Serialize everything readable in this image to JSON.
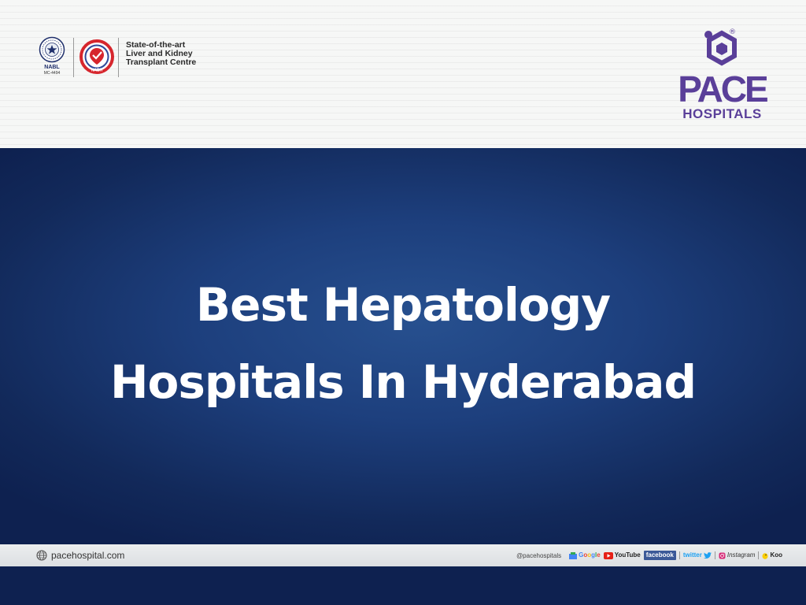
{
  "header": {
    "nabl": {
      "label": "NABL",
      "code": "MC-4494"
    },
    "nabh_label": "NABH",
    "tagline": [
      "State-of-the-art",
      "Liver and Kidney",
      "Transplant Centre"
    ],
    "brand": {
      "name": "PACE",
      "subname": "HOSPITALS",
      "registered": "®"
    }
  },
  "hero": {
    "title_lines": [
      "Best Hepatology",
      "Hospitals In Hyderabad"
    ]
  },
  "footer": {
    "website": "pacehospital.com",
    "handle": "@pacehospitals",
    "socials": {
      "google": "Google",
      "youtube": "YouTube",
      "facebook": "facebook",
      "twitter": "twitter",
      "instagram": "Instagram",
      "koo": "Koo"
    }
  },
  "colors": {
    "brand_purple": "#5a3f99",
    "hero_blue": "#1d3f7d",
    "title_text": "#ffffff"
  }
}
